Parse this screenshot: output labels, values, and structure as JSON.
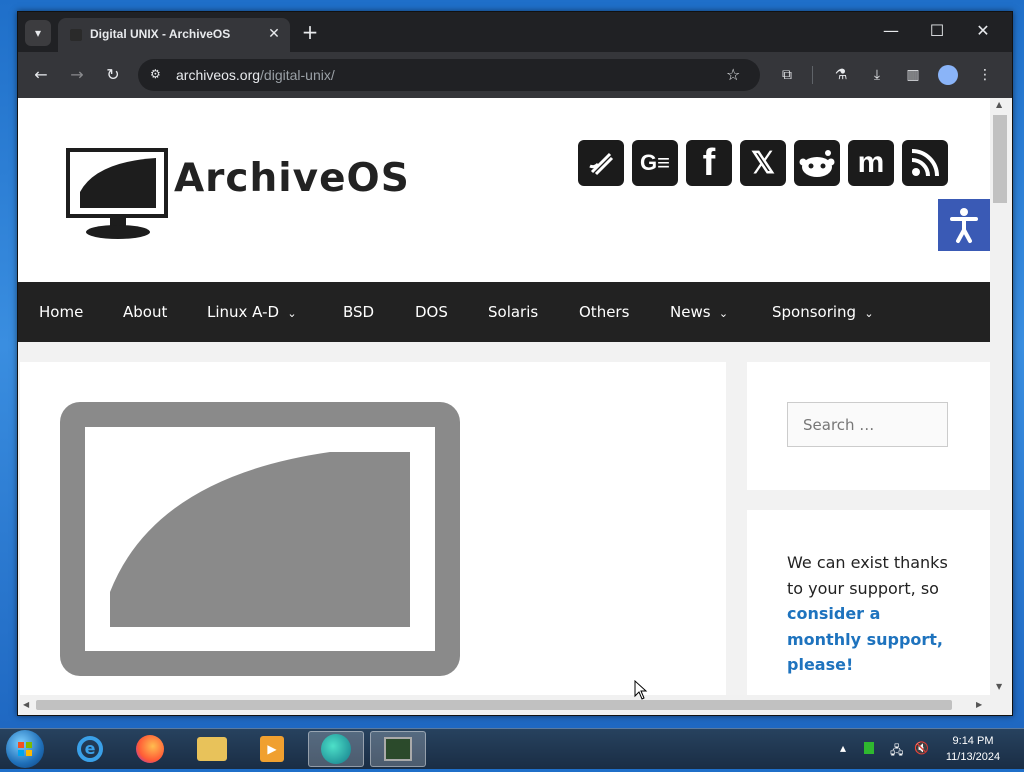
{
  "browser": {
    "tab_title": "Digital UNIX - ArchiveOS",
    "url_domain": "archiveos.org",
    "url_path": "/digital-unix/"
  },
  "site": {
    "logo_text": "ArchiveOS",
    "social": [
      {
        "icon": "steam-icon"
      },
      {
        "icon": "gettr-icon",
        "label": "G≡"
      },
      {
        "icon": "facebook-icon",
        "label": "f"
      },
      {
        "icon": "x-icon",
        "label": "𝕏"
      },
      {
        "icon": "reddit-icon"
      },
      {
        "icon": "mastodon-icon",
        "label": "m"
      },
      {
        "icon": "rss-icon"
      }
    ],
    "nav": [
      "Home",
      "About",
      "Linux A-D",
      "BSD",
      "DOS",
      "Solaris",
      "Others",
      "News",
      "Sponsoring"
    ],
    "search_placeholder": "Search …",
    "support_text_1": "We can exist thanks to your support, so",
    "support_text_2": "consider a monthly support, please!"
  },
  "taskbar": {
    "time": "9:14 PM",
    "date": "11/13/2024"
  },
  "colors": {
    "nav_bg": "#222222",
    "accent": "#1e73be",
    "a11y": "#3a5ab5"
  }
}
